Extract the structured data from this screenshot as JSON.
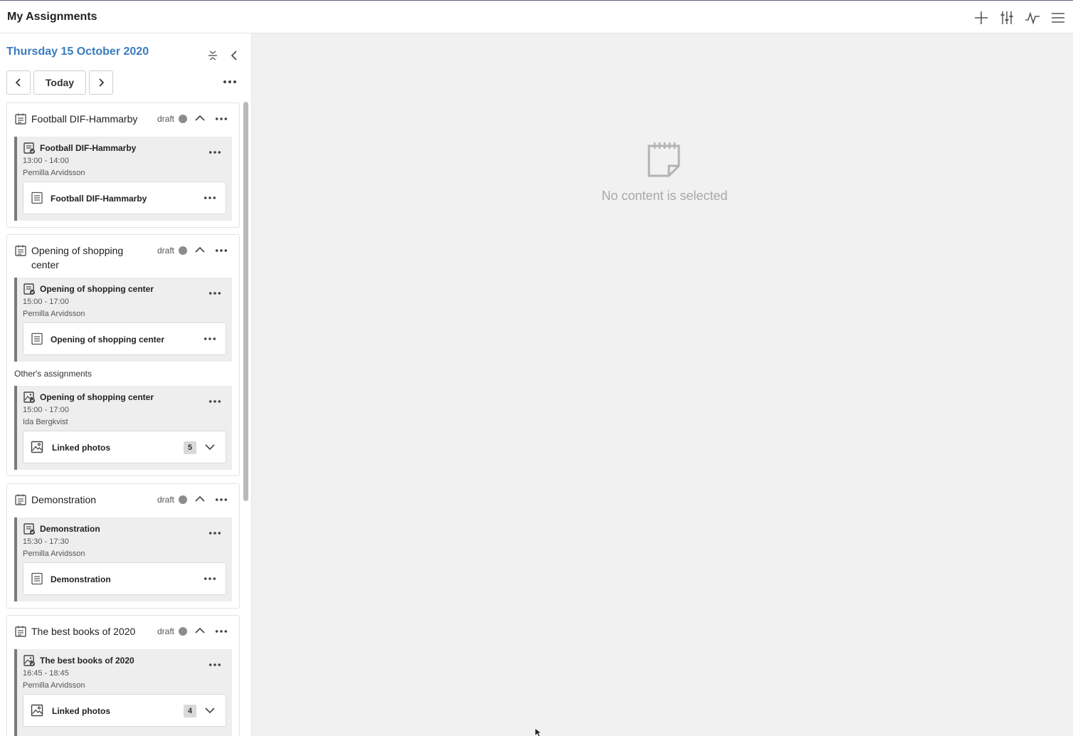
{
  "app": {
    "title": "My Assignments",
    "toolbar_icons": [
      "plus-icon",
      "sliders-icon",
      "activity-icon",
      "menu-icon"
    ]
  },
  "sidebar": {
    "date": "Thursday 15 October 2020",
    "today_label": "Today"
  },
  "groups": [
    {
      "title": "Football DIF-Hammarby",
      "status": "draft",
      "assignment": {
        "title": "Football DIF-Hammarby",
        "time": "13:00 - 14:00",
        "person": "Pernilla Arvidsson",
        "item": {
          "title": "Football DIF-Hammarby"
        }
      }
    },
    {
      "title": "Opening of shopping center",
      "status": "draft",
      "assignment": {
        "title": "Opening of shopping center",
        "time": "15:00 - 17:00",
        "person": "Pernilla Arvidsson",
        "item": {
          "title": "Opening of shopping center"
        }
      },
      "others_label": "Other's assignments",
      "other_assignment": {
        "title": "Opening of shopping center",
        "time": "15:00 - 17:00",
        "person": "Ida Bergkvist",
        "item": {
          "title": "Linked photos",
          "count": "5"
        }
      }
    },
    {
      "title": "Demonstration",
      "status": "draft",
      "assignment": {
        "title": "Demonstration",
        "time": "15:30 - 17:30",
        "person": "Pernilla Arvidsson",
        "item": {
          "title": "Demonstration"
        }
      }
    },
    {
      "title": "The best books of 2020",
      "status": "draft",
      "assignment": {
        "title": "The best books of 2020",
        "time": "16:45 - 18:45",
        "person": "Pernilla Arvidsson",
        "item": {
          "title": "Linked photos",
          "count": "4"
        }
      }
    }
  ],
  "empty_state": {
    "text": "No content is selected"
  },
  "colors": {
    "accent": "#3a7bbf",
    "status_dot": "#8c8c8c",
    "card_border": "#7a7a7a"
  }
}
